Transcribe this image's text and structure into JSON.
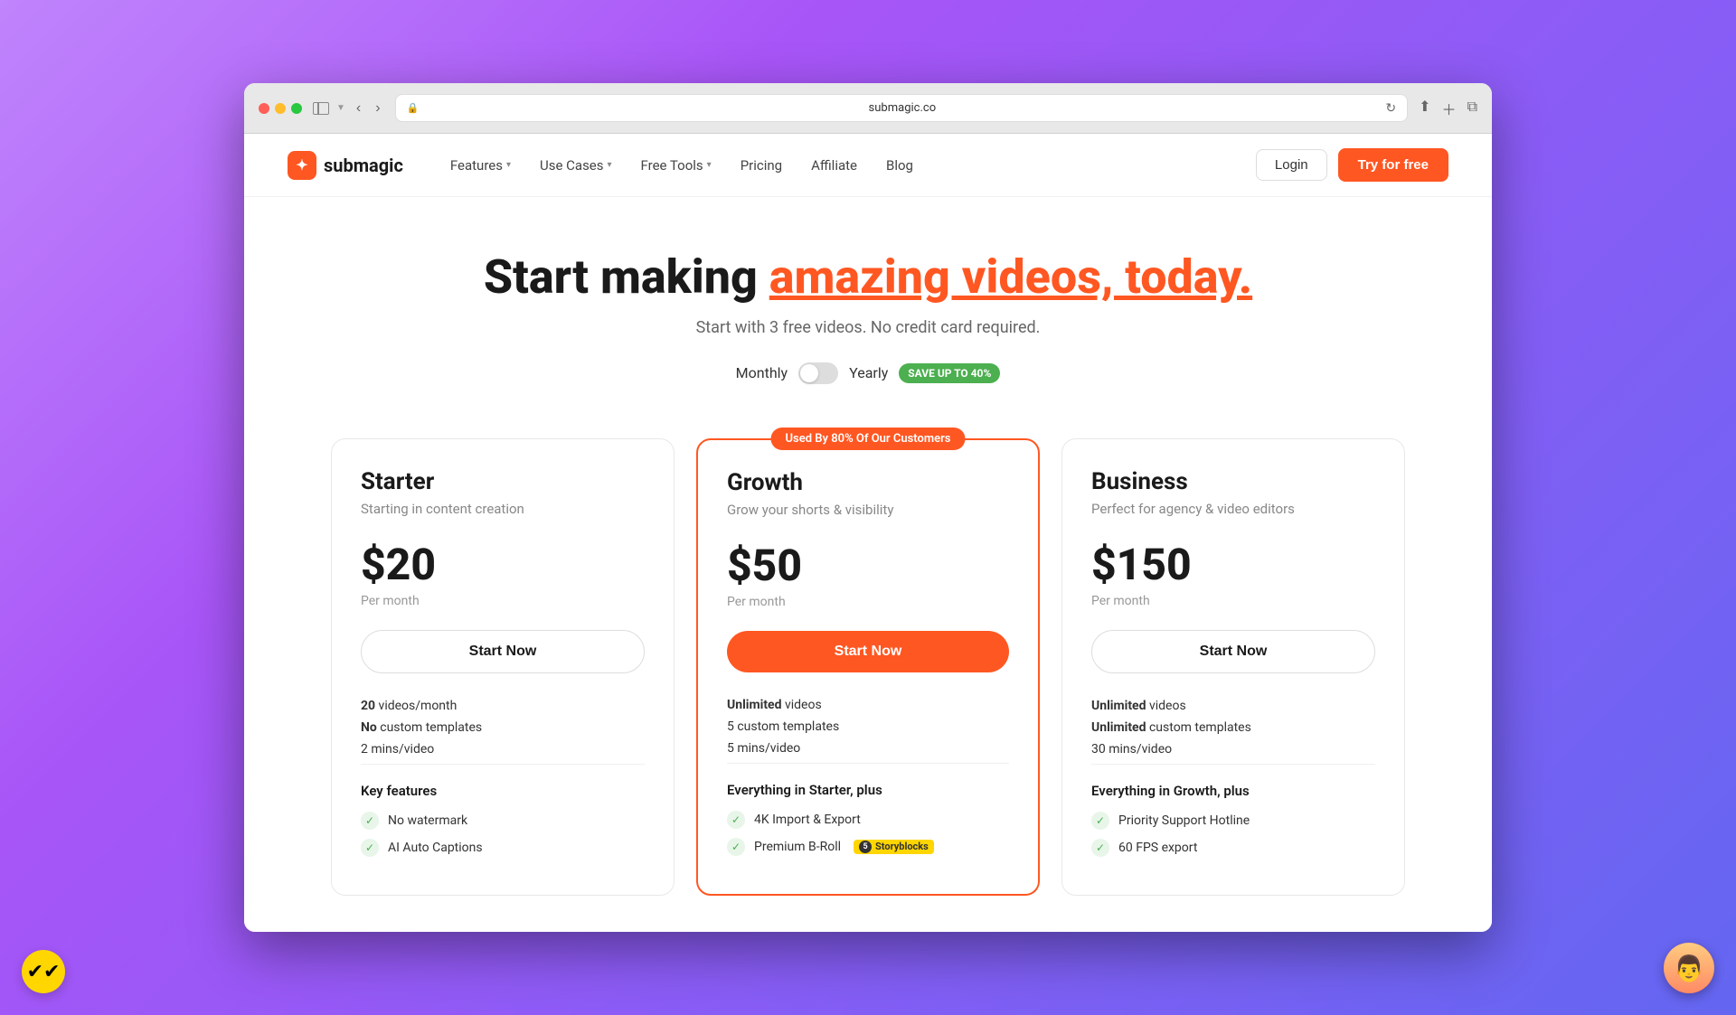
{
  "browser": {
    "url": "submagic.co",
    "refresh_title": "Refresh"
  },
  "nav": {
    "logo_text": "submagic",
    "logo_icon": "✦",
    "items": [
      {
        "label": "Features",
        "has_dropdown": true
      },
      {
        "label": "Use Cases",
        "has_dropdown": true
      },
      {
        "label": "Free Tools",
        "has_dropdown": true
      },
      {
        "label": "Pricing",
        "has_dropdown": false
      },
      {
        "label": "Affiliate",
        "has_dropdown": false
      },
      {
        "label": "Blog",
        "has_dropdown": false
      }
    ],
    "login_label": "Login",
    "try_label": "Try for free"
  },
  "hero": {
    "title_static": "Start making ",
    "title_highlight": "amazing videos, today.",
    "subtitle": "Start with 3 free videos. No credit card required.",
    "billing_monthly": "Monthly",
    "billing_yearly": "Yearly",
    "save_badge": "SAVE UP TO 40%"
  },
  "plans": [
    {
      "id": "starter",
      "name": "Starter",
      "desc": "Starting in content creation",
      "price": "$20",
      "period": "Per month",
      "cta": "Start Now",
      "cta_style": "outline",
      "featured": false,
      "stats": [
        {
          "bold": "20",
          "text": " videos/month"
        },
        {
          "bold": "No",
          "text": " custom templates"
        },
        {
          "text": "2 mins/video"
        }
      ],
      "features_label": "Key features",
      "features": [
        {
          "text": "No watermark"
        },
        {
          "text": "AI Auto Captions"
        }
      ]
    },
    {
      "id": "growth",
      "name": "Growth",
      "desc": "Grow your shorts & visibility",
      "price": "$50",
      "period": "Per month",
      "cta": "Start Now",
      "cta_style": "filled",
      "featured": true,
      "featured_badge": "Used By 80% Of Our Customers",
      "stats": [
        {
          "bold": "Unlimited",
          "text": " videos"
        },
        {
          "text": "5 custom templates"
        },
        {
          "text": "5 mins/video"
        }
      ],
      "features_label": "Everything in Starter, plus",
      "features": [
        {
          "text": "4K Import & Export"
        },
        {
          "text": "Premium B-Roll",
          "badge": true,
          "badge_num": "5",
          "badge_text": "Storyblocks"
        }
      ]
    },
    {
      "id": "business",
      "name": "Business",
      "desc": "Perfect for agency & video editors",
      "price": "$150",
      "period": "Per month",
      "cta": "Start Now",
      "cta_style": "outline",
      "featured": false,
      "stats": [
        {
          "bold": "Unlimited",
          "text": " videos"
        },
        {
          "bold": "Unlimited",
          "text": " custom templates"
        },
        {
          "text": "30 mins/video"
        }
      ],
      "features_label": "Everything in Growth, plus",
      "features": [
        {
          "text": "Priority Support Hotline"
        },
        {
          "text": "60 FPS export"
        }
      ]
    }
  ]
}
